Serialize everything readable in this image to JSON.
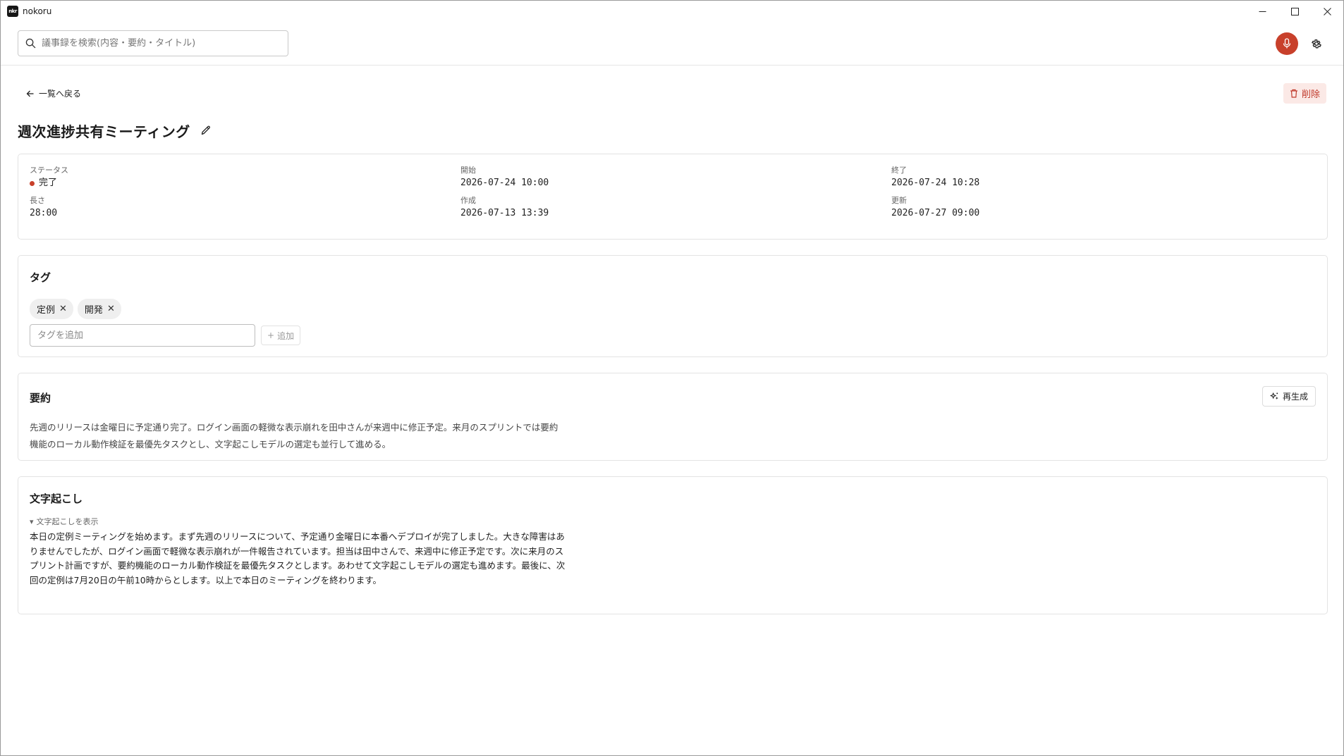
{
  "window": {
    "app_title": "nokoru",
    "logo_text": "nkr"
  },
  "search": {
    "placeholder": "議事録を検索(内容・要約・タイトル)"
  },
  "nav": {
    "back_label": "一覧へ戻る",
    "delete_label": "削除"
  },
  "meeting": {
    "title": "週次進捗共有ミーティング"
  },
  "meta": {
    "status_label": "ステータス",
    "status_value": "完了",
    "start_label": "開始",
    "start_value": "2026-07-24 10:00",
    "end_label": "終了",
    "end_value": "2026-07-24 10:28",
    "length_label": "長さ",
    "length_value": "28:00",
    "created_label": "作成",
    "created_value": "2026-07-13 13:39",
    "updated_label": "更新",
    "updated_value": "2026-07-27 09:00"
  },
  "tags": {
    "heading": "タグ",
    "items": [
      {
        "label": "定例"
      },
      {
        "label": "開発"
      }
    ],
    "input_placeholder": "タグを追加",
    "add_label": "追加"
  },
  "summary": {
    "heading": "要約",
    "regenerate_label": "再生成",
    "text": "先週のリリースは金曜日に予定通り完了。ログイン画面の軽微な表示崩れを田中さんが来週中に修正予定。来月のスプリントでは要約機能のローカル動作検証を最優先タスクとし、文字起こしモデルの選定も並行して進める。"
  },
  "transcript": {
    "heading": "文字起こし",
    "toggle_label": "文字起こしを表示",
    "text": "本日の定例ミーティングを始めます。まず先週のリリースについて、予定通り金曜日に本番へデプロイが完了しました。大きな障害はありませんでしたが、ログイン画面で軽微な表示崩れが一件報告されています。担当は田中さんで、来週中に修正予定です。次に来月のスプリント計画ですが、要約機能のローカル動作検証を最優先タスクとします。あわせて文字起こしモデルの選定も進めます。最後に、次回の定例は7月20日の午前10時からとします。以上で本日のミーティングを終わります。"
  },
  "colors": {
    "accent_red": "#c8402b",
    "delete_bg": "#fbe9e6"
  }
}
